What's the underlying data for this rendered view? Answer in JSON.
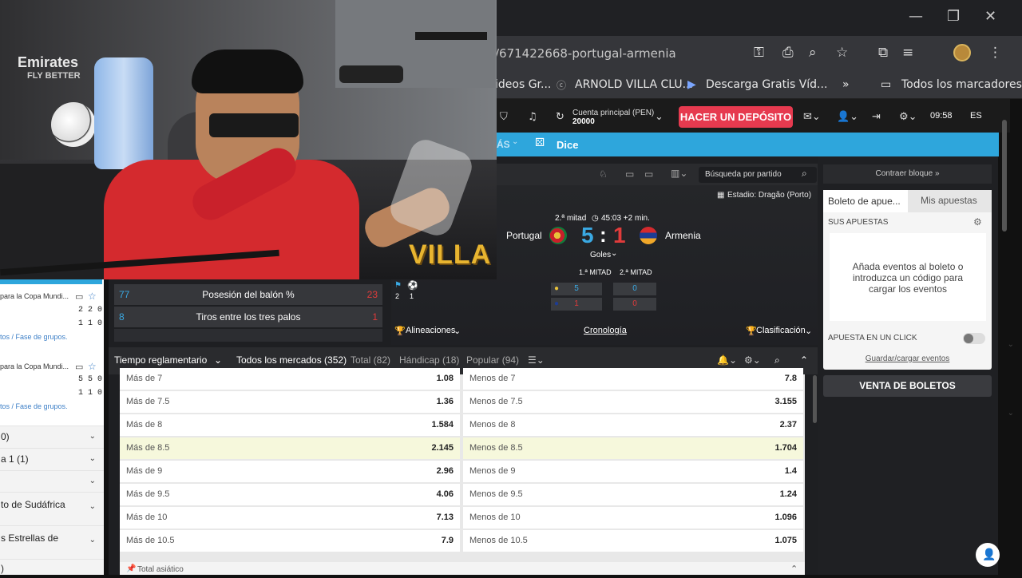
{
  "browser": {
    "url": "/671422668-portugal-armenia",
    "bookmarks": [
      "ideos Gr...",
      "ARNOLD VILLA CLU...",
      "Descarga Gratis Víd...",
      "»",
      "Todos los marcadores"
    ]
  },
  "header": {
    "account_label": "Cuenta principal  (PEN)",
    "account_value": "20000",
    "deposit": "HACER UN DEPÓSITO",
    "time": "09:58",
    "lang": "ES"
  },
  "nav": {
    "mas": "ÁS",
    "dice": "Dice"
  },
  "sidebar": {
    "items": [
      {
        "title": "para la Copa Mundi...",
        "score1": "2 2 0",
        "score2": "1 1 0",
        "breadcrumb": "tos / Fase de grupos."
      },
      {
        "title": "para la Copa Mundi...",
        "score1": "5 5 0",
        "score2": "1 1 0",
        "breadcrumb": "tos / Fase de grupos."
      }
    ],
    "rows": [
      "0)",
      "a 1 (1)",
      "",
      "to de Sudáfrica",
      "s Estrellas de",
      ")"
    ]
  },
  "gamebar": {
    "search_placeholder": "Búsqueda por partido"
  },
  "match": {
    "stadium": "Estadio: Dragão (Porto)",
    "period": "2.ª mitad",
    "clock": "45:03 +2 min.",
    "home": "Portugal",
    "away": "Armenia",
    "home_score": "5",
    "away_score": "1",
    "sep": ":",
    "goals_dropdown": "Goles",
    "half1": "1.ª MITAD",
    "half2": "2.ª MITAD",
    "h1_home": "5",
    "h2_home": "0",
    "h1_away": "1",
    "h2_away": "0",
    "corner": "2",
    "yellow": "1",
    "lineups": "Alineaciones",
    "timeline": "Cronología",
    "standings": "Clasificación"
  },
  "stats": [
    {
      "home": "77",
      "label": "Posesión del balón %",
      "away": "23"
    },
    {
      "home": "8",
      "label": "Tiros entre los tres palos",
      "away": "1"
    }
  ],
  "tabs": {
    "period": "Tiempo reglamentario",
    "all": "Todos los mercados (352)",
    "total": "Total (82)",
    "handicap": "Hándicap (18)",
    "popular": "Popular (94)"
  },
  "market": {
    "rows": [
      {
        "over": "Más de 7",
        "over_odds": "1.08",
        "under": "Menos de 7",
        "under_odds": "7.8"
      },
      {
        "over": "Más de 7.5",
        "over_odds": "1.36",
        "under": "Menos de 7.5",
        "under_odds": "3.155"
      },
      {
        "over": "Más de 8",
        "over_odds": "1.584",
        "under": "Menos de 8",
        "under_odds": "2.37"
      },
      {
        "over": "Más de 8.5",
        "over_odds": "2.145",
        "under": "Menos de 8.5",
        "under_odds": "1.704"
      },
      {
        "over": "Más de 9",
        "over_odds": "2.96",
        "under": "Menos de 9",
        "under_odds": "1.4"
      },
      {
        "over": "Más de 9.5",
        "over_odds": "4.06",
        "under": "Menos de 9.5",
        "under_odds": "1.24"
      },
      {
        "over": "Más de 10",
        "over_odds": "7.13",
        "under": "Menos de 10",
        "under_odds": "1.096"
      },
      {
        "over": "Más de 10.5",
        "over_odds": "7.9",
        "under": "Menos de 10.5",
        "under_odds": "1.075"
      }
    ],
    "next_section": "Total asiático"
  },
  "betslip": {
    "collapse": "Contraer bloque »",
    "tab_slip": "Boleto de apue...",
    "tab_mybets": "Mis apuestas",
    "your_bets": "SUS APUESTAS",
    "empty": "Añada eventos al boleto o introduzca un código para cargar los eventos",
    "oneclick": "APUESTA EN UN CLICK",
    "save_load": "Guardar/cargar eventos",
    "sell": "VENTA DE BOLETOS"
  },
  "webcam": {
    "brand1": "Emirates",
    "brand2": "FLY BETTER",
    "overlay": "VILLA"
  },
  "colors": {
    "accent_red": "#e63a4f",
    "nav_blue": "#2ea6dc",
    "home_blue": "#3aa9e3",
    "away_red": "#e03b3b"
  }
}
